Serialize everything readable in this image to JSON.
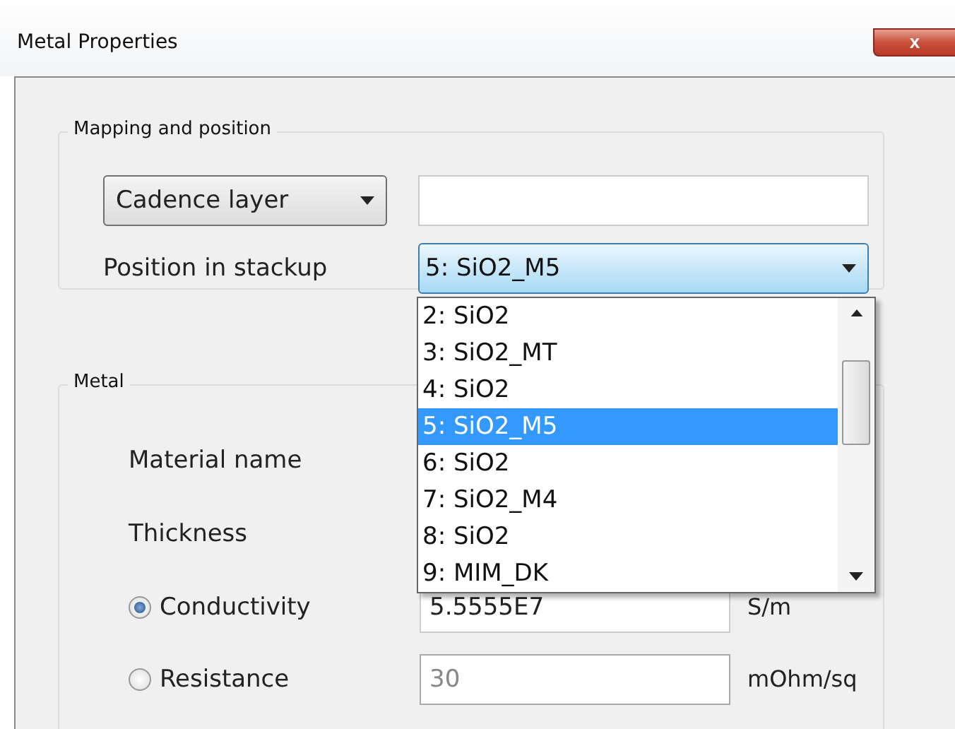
{
  "window": {
    "title": "Metal Properties",
    "close": "x"
  },
  "mapping": {
    "title": "Mapping and position",
    "layer_select": "Cadence layer",
    "position_label": "Position in stackup",
    "position_value": "5:  SiO2_M5",
    "options": [
      {
        "label": "2:  SiO2",
        "selected": false
      },
      {
        "label": "3:  SiO2_MT",
        "selected": false
      },
      {
        "label": "4:  SiO2",
        "selected": false
      },
      {
        "label": "5:  SiO2_M5",
        "selected": true
      },
      {
        "label": "6:  SiO2",
        "selected": false
      },
      {
        "label": "7:  SiO2_M4",
        "selected": false
      },
      {
        "label": "8:  SiO2",
        "selected": false
      },
      {
        "label": "9:  MIM_DK",
        "selected": false
      }
    ]
  },
  "metal": {
    "title": "Metal",
    "material_label": "Material name",
    "thickness_label": "Thickness",
    "modes": [
      {
        "label": "Conductivity",
        "selected": true,
        "value": "5.5555E7",
        "unit": "S/m"
      },
      {
        "label": "Resistance",
        "selected": false,
        "value": "30",
        "unit": "mOhm/sq"
      }
    ]
  }
}
